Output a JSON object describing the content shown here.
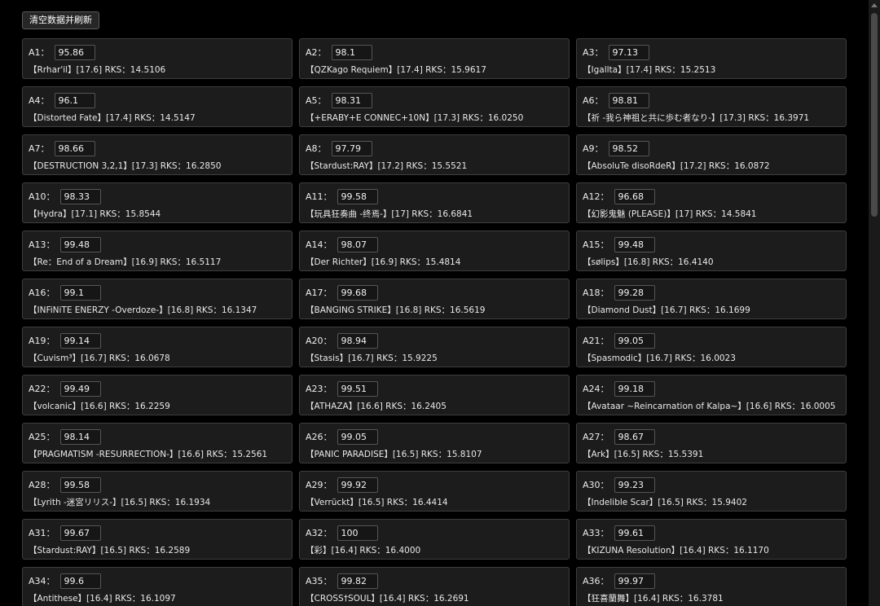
{
  "toolbar": {
    "clear_label": "清空数据并刷新"
  },
  "records": [
    {
      "rank": "A1：",
      "acc": "95.86",
      "info": "【Rrhar'il】[17.6] RKS：14.5106"
    },
    {
      "rank": "A2：",
      "acc": "98.1",
      "info": "【QZKago Requiem】[17.4] RKS：15.9617"
    },
    {
      "rank": "A3：",
      "acc": "97.13",
      "info": "【Igallta】[17.4] RKS：15.2513"
    },
    {
      "rank": "A4：",
      "acc": "96.1",
      "info": "【Distorted Fate】[17.4] RKS：14.5147"
    },
    {
      "rank": "A5：",
      "acc": "98.31",
      "info": "【+ERABY+E CONNEC+10N】[17.3] RKS：16.0250"
    },
    {
      "rank": "A6：",
      "acc": "98.81",
      "info": "【祈 -我ら神祖と共に歩む者なり-】[17.3] RKS：16.3971"
    },
    {
      "rank": "A7：",
      "acc": "98.66",
      "info": "【DESTRUCTION 3,2,1】[17.3] RKS：16.2850"
    },
    {
      "rank": "A8：",
      "acc": "97.79",
      "info": "【Stardust:RAY】[17.2] RKS：15.5521"
    },
    {
      "rank": "A9：",
      "acc": "98.52",
      "info": "【AbsoluTe disoRdeR】[17.2] RKS：16.0872"
    },
    {
      "rank": "A10：",
      "acc": "98.33",
      "info": "【Hydra】[17.1] RKS：15.8544"
    },
    {
      "rank": "A11：",
      "acc": "99.58",
      "info": "【玩具狂奏曲 -终焉-】[17] RKS：16.6841"
    },
    {
      "rank": "A12：",
      "acc": "96.68",
      "info": "【幻影鬼魅 (PLEASE)】[17] RKS：14.5841"
    },
    {
      "rank": "A13：",
      "acc": "99.48",
      "info": "【Re：End of a Dream】[16.9] RKS：16.5117"
    },
    {
      "rank": "A14：",
      "acc": "98.07",
      "info": "【Der Richter】[16.9] RKS：15.4814"
    },
    {
      "rank": "A15：",
      "acc": "99.48",
      "info": "【sølips】[16.8] RKS：16.4140"
    },
    {
      "rank": "A16：",
      "acc": "99.1",
      "info": "【INFiNiTE ENERZY -Overdoze-】[16.8] RKS：16.1347"
    },
    {
      "rank": "A17：",
      "acc": "99.68",
      "info": "【BANGING STRIKE】[16.8] RKS：16.5619"
    },
    {
      "rank": "A18：",
      "acc": "99.28",
      "info": "【Diamond Dust】[16.7] RKS：16.1699"
    },
    {
      "rank": "A19：",
      "acc": "99.14",
      "info": "【Cuvism³】[16.7] RKS：16.0678"
    },
    {
      "rank": "A20：",
      "acc": "98.94",
      "info": "【Stasis】[16.7] RKS：15.9225"
    },
    {
      "rank": "A21：",
      "acc": "99.05",
      "info": "【Spasmodic】[16.7] RKS：16.0023"
    },
    {
      "rank": "A22：",
      "acc": "99.49",
      "info": "【volcanic】[16.6] RKS：16.2259"
    },
    {
      "rank": "A23：",
      "acc": "99.51",
      "info": "【ATHAZA】[16.6] RKS：16.2405"
    },
    {
      "rank": "A24：",
      "acc": "99.18",
      "info": "【Avataar ~Reincarnation of Kalpa~】[16.6] RKS：16.0005"
    },
    {
      "rank": "A25：",
      "acc": "98.14",
      "info": "【PRAGMATISM -RESURRECTION-】[16.6] RKS：15.2561"
    },
    {
      "rank": "A26：",
      "acc": "99.05",
      "info": "【PANIC PARADISE】[16.5] RKS：15.8107"
    },
    {
      "rank": "A27：",
      "acc": "98.67",
      "info": "【Ark】[16.5] RKS：15.5391"
    },
    {
      "rank": "A28：",
      "acc": "99.58",
      "info": "【Lyrith -迷宮リリス-】[16.5] RKS：16.1934"
    },
    {
      "rank": "A29：",
      "acc": "99.92",
      "info": "【Verrückt】[16.5] RKS：16.4414"
    },
    {
      "rank": "A30：",
      "acc": "99.23",
      "info": "【Indelible Scar】[16.5] RKS：15.9402"
    },
    {
      "rank": "A31：",
      "acc": "99.67",
      "info": "【Stardust:RAY】[16.5] RKS：16.2589"
    },
    {
      "rank": "A32：",
      "acc": "100",
      "info": "【彩】[16.4] RKS：16.4000"
    },
    {
      "rank": "A33：",
      "acc": "99.61",
      "info": "【KIZUNA Resolution】[16.4] RKS：16.1170"
    },
    {
      "rank": "A34：",
      "acc": "99.6",
      "info": "【Antithese】[16.4] RKS：16.1097"
    },
    {
      "rank": "A35：",
      "acc": "99.82",
      "info": "【CROSS†SOUL】[16.4] RKS：16.2691"
    },
    {
      "rank": "A36：",
      "acc": "99.97",
      "info": "【狂喜蘭舞】[16.4] RKS：16.3781"
    }
  ]
}
